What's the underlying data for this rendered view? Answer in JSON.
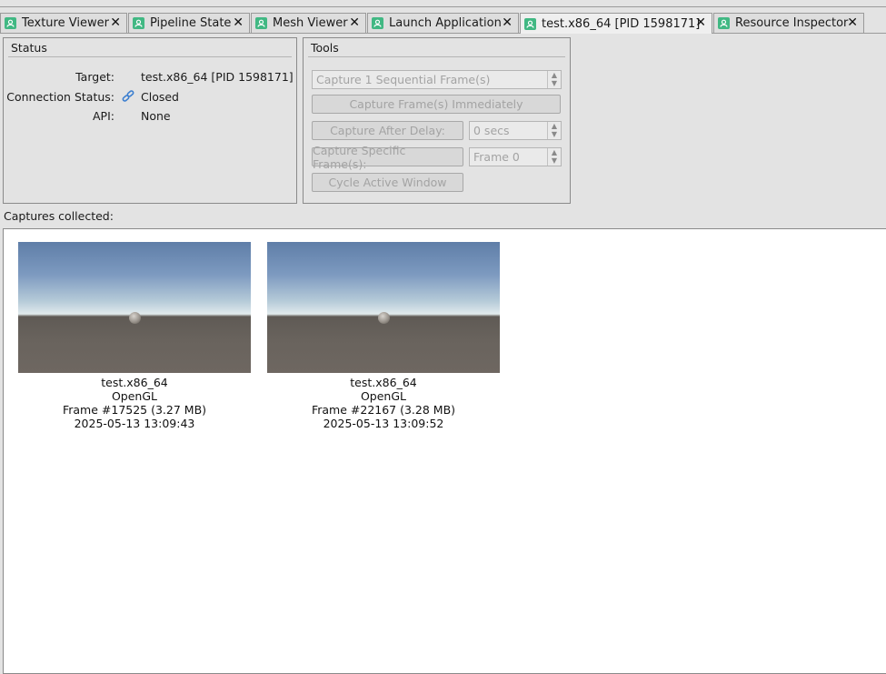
{
  "tabs": [
    {
      "label": "Texture Viewer",
      "icon": "window-icon"
    },
    {
      "label": "Pipeline State",
      "icon": "window-icon"
    },
    {
      "label": "Mesh Viewer",
      "icon": "window-icon"
    },
    {
      "label": "Launch Application",
      "icon": "window-icon"
    },
    {
      "label": "test.x86_64 [PID 1598171]",
      "icon": "window-icon",
      "active": true
    },
    {
      "label": "Resource Inspector",
      "icon": "window-icon"
    }
  ],
  "close_glyph": "✕",
  "status": {
    "title": "Status",
    "target_label": "Target:",
    "target_value": "test.x86_64 [PID 1598171]",
    "connection_label": "Connection Status:",
    "connection_value": "Closed",
    "api_label": "API:",
    "api_value": "None"
  },
  "tools": {
    "title": "Tools",
    "sequential_value": "Capture 1 Sequential Frame(s)",
    "capture_now_label": "Capture Frame(s) Immediately",
    "capture_delay_label": "Capture After Delay:",
    "delay_value": "0 secs",
    "capture_specific_label": "Capture Specific Frame(s):",
    "frame_value": "Frame 0",
    "cycle_window_label": "Cycle Active Window"
  },
  "captures": {
    "label": "Captures collected:",
    "items": [
      {
        "name": "test.x86_64",
        "api": "OpenGL",
        "frame": "Frame #17525 (3.27 MB)",
        "timestamp": "2025-05-13 13:09:43"
      },
      {
        "name": "test.x86_64",
        "api": "OpenGL",
        "frame": "Frame #22167 (3.28 MB)",
        "timestamp": "2025-05-13 13:09:52"
      }
    ]
  },
  "colors": {
    "tab_icon": "#41b883",
    "disabled_text": "#a3a3a3"
  }
}
